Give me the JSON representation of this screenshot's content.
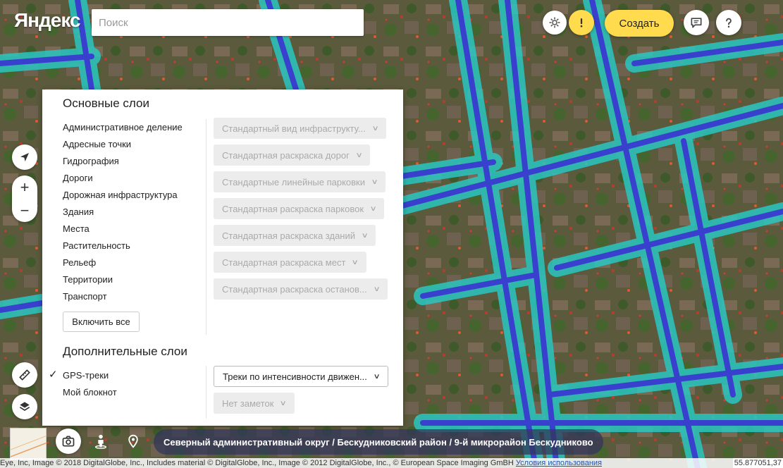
{
  "header": {
    "logo": "Яндекс",
    "search_placeholder": "Поиск",
    "create_label": "Создать"
  },
  "map_controls": {
    "zoom_in": "+",
    "zoom_out": "−"
  },
  "panel": {
    "main_title": "Основные слои",
    "layers": [
      "Административное деление",
      "Адресные точки",
      "Гидрография",
      "Дороги",
      "Дорожная инфраструктура",
      "Здания",
      "Места",
      "Растительность",
      "Рельеф",
      "Территории",
      "Транспорт"
    ],
    "selects": [
      "Стандартный вид инфраструкту...",
      "Стандартная раскраска дорог",
      "Стандартные линейные парковки",
      "Стандартная раскраска парковок",
      "Стандартная раскраска зданий",
      "Стандартная раскраска мест",
      "Стандартная раскраска останов..."
    ],
    "enable_all": "Включить все",
    "extra_title": "Дополнительные слои",
    "extra_layers": [
      "GPS-треки",
      "Мой блокнот"
    ],
    "check_mark": "✓",
    "extra_selects": [
      "Треки по интенсивности движен...",
      "Нет заметок"
    ]
  },
  "bottom": {
    "breadcrumb": "Северный административный округ / Бескудниковский район / 9-й микрорайон Бескудниково",
    "attribution": "Eye, Inc, Image © 2018 DigitalGlobe, Inc., Includes material © DigitalGlobe, Inc., Image © 2012 DigitalGlobe, Inc., © European Space Imaging GmBH",
    "terms": "Условия использования",
    "coords": "55.877051,37"
  },
  "colors": {
    "accent": "#ffdb4d",
    "road_core": "#3a3ad0",
    "road_halo": "#29c7c0"
  }
}
